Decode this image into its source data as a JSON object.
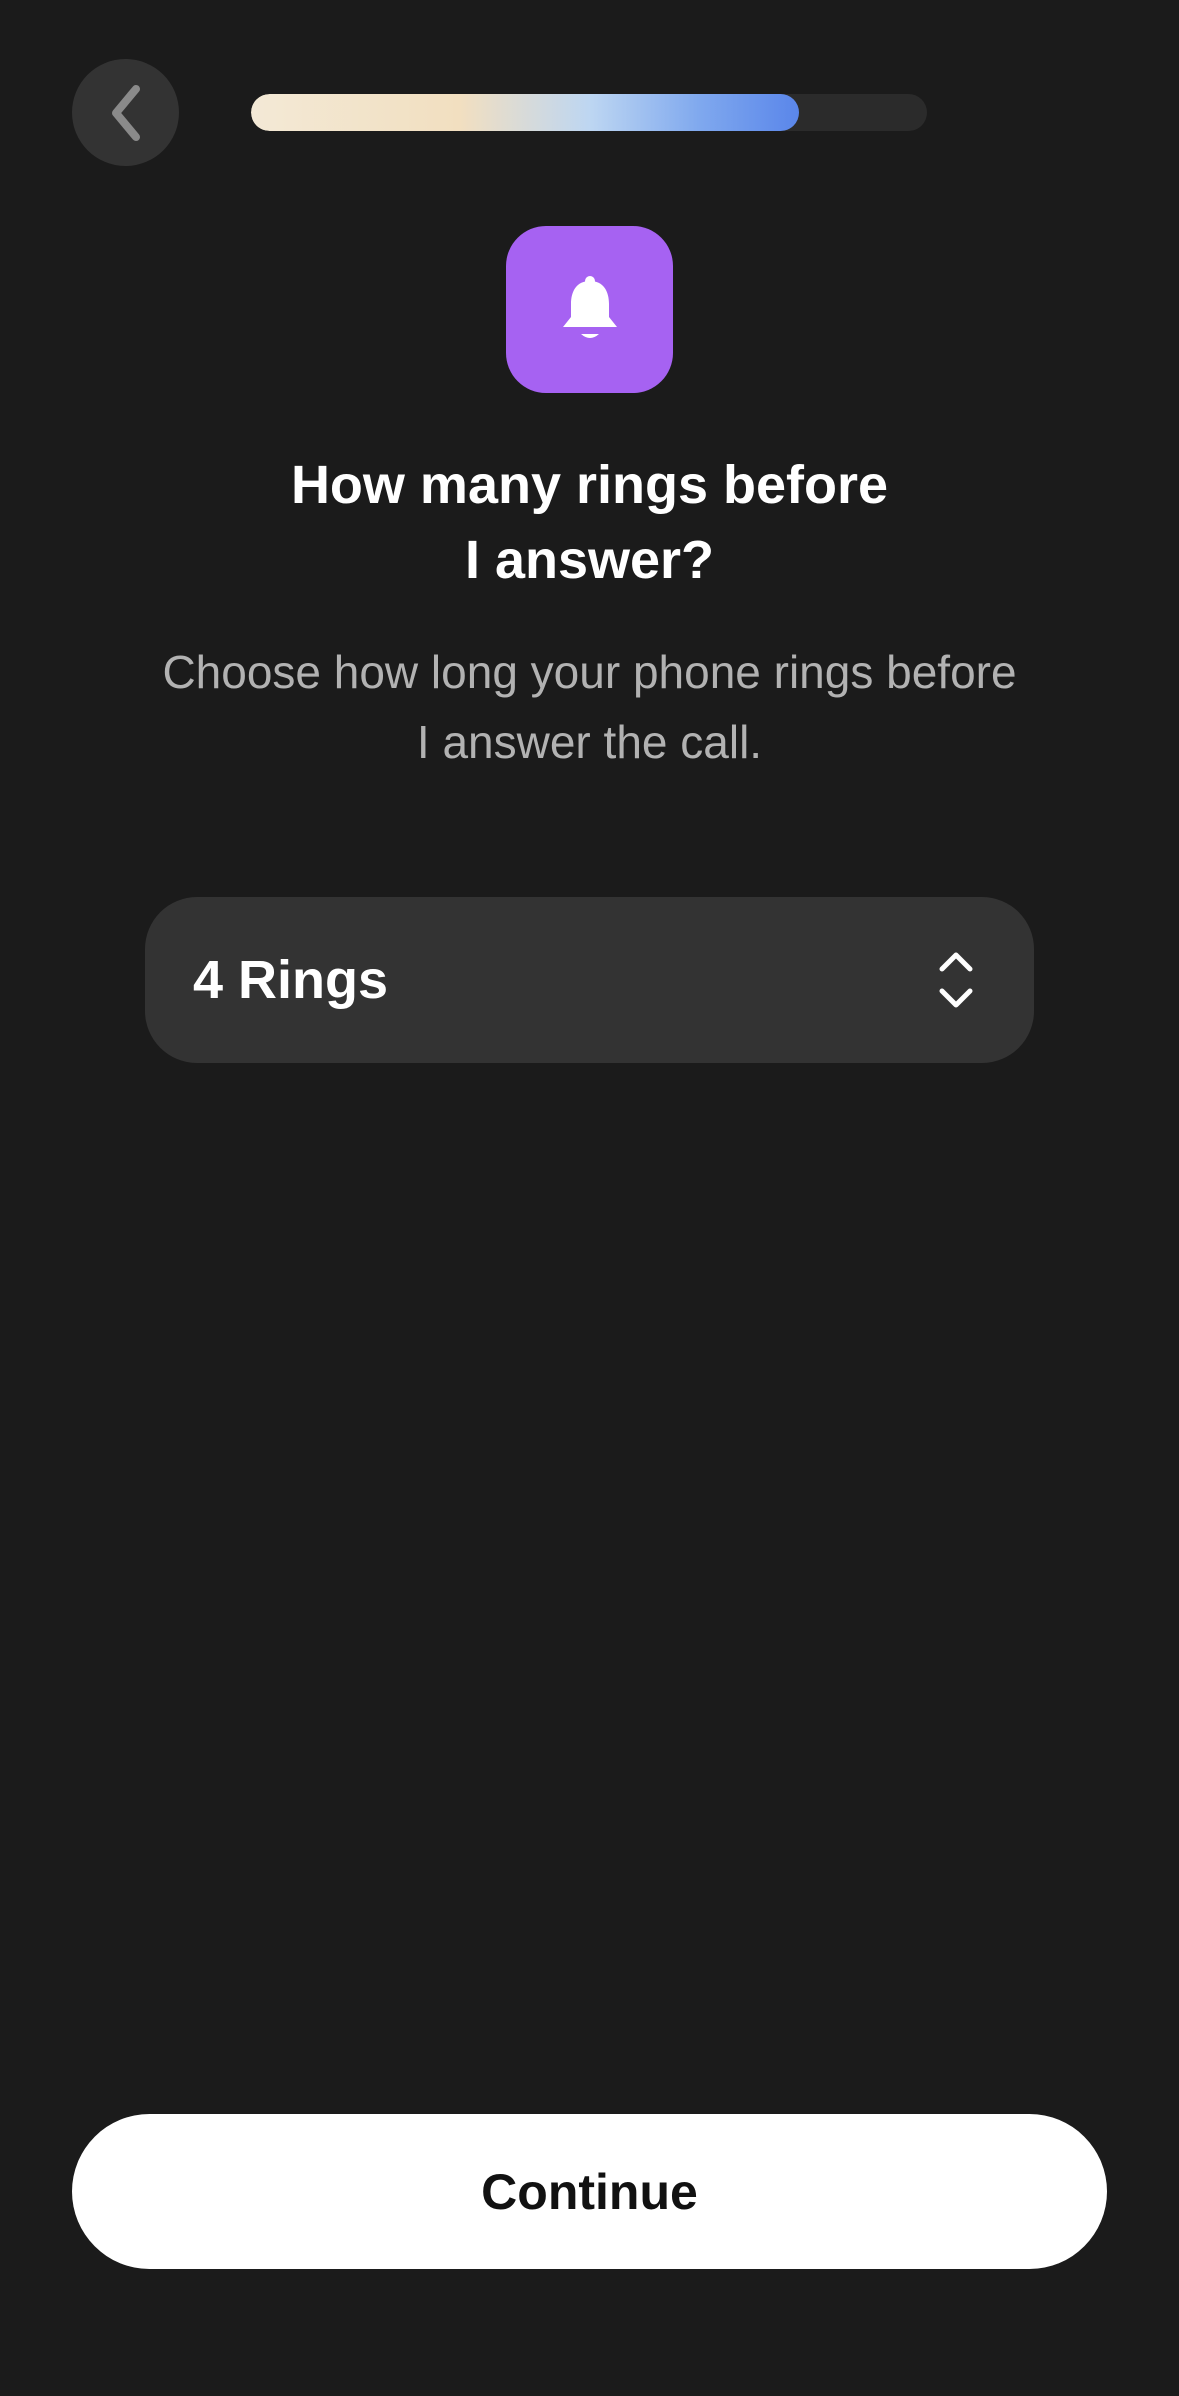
{
  "header": {
    "back_icon": "chevron-left-icon",
    "progress_fraction": 0.81
  },
  "hero": {
    "icon": "bell-icon",
    "icon_color": "#a662f2",
    "title": "How many rings before\nI answer?",
    "subtitle": "Choose how long your phone rings before\nI answer the call."
  },
  "ring_select": {
    "value": "4 Rings",
    "icon": "chevron-up-down-icon"
  },
  "footer": {
    "continue_label": "Continue"
  },
  "colors": {
    "background": "#1b1b1b",
    "control_surface": "#333333",
    "primary_button": "#ffffff",
    "accent_gradient_start": "#f3e9d6",
    "accent_gradient_end": "#5a86ea"
  }
}
